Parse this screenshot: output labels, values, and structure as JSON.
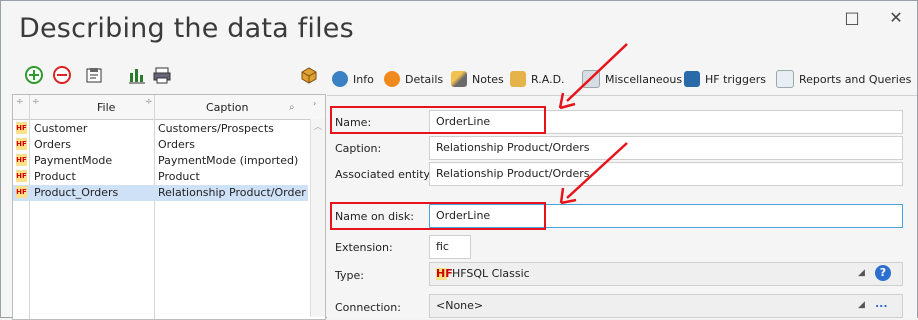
{
  "window": {
    "title": "Describing the data files",
    "minimize": "□",
    "close": "✕"
  },
  "grid": {
    "headers": {
      "file": "File",
      "caption": "Caption"
    },
    "rows": [
      {
        "file": "Customer",
        "caption": "Customers/Prospects"
      },
      {
        "file": "Orders",
        "caption": "Orders"
      },
      {
        "file": "PaymentMode",
        "caption": "PaymentMode (imported)"
      },
      {
        "file": "Product",
        "caption": "Product"
      },
      {
        "file": "Product_Orders",
        "caption": "Relationship Product/Order"
      }
    ],
    "hf_badge": "HF"
  },
  "tabs": [
    "Info",
    "Details",
    "Notes",
    "R.A.D.",
    "Miscellaneous",
    "HF triggers",
    "Reports and Queries"
  ],
  "form": {
    "name_label": "Name:",
    "name_value": "OrderLine",
    "caption_label": "Caption:",
    "caption_value": "Relationship Product/Orders",
    "assoc_label": "Associated entity:",
    "assoc_value": "Relationship Product/Orders",
    "disk_label": "Name on disk:",
    "disk_value": "OrderLine",
    "ext_label": "Extension:",
    "ext_value": "fic",
    "type_label": "Type:",
    "type_value": "HFSQL Classic",
    "type_badge": "HF",
    "conn_label": "Connection:",
    "conn_value": "<None>",
    "conn_more": "..."
  },
  "colors": {
    "highlight": "#e8121b",
    "selected_row": "#cfe1f7"
  }
}
